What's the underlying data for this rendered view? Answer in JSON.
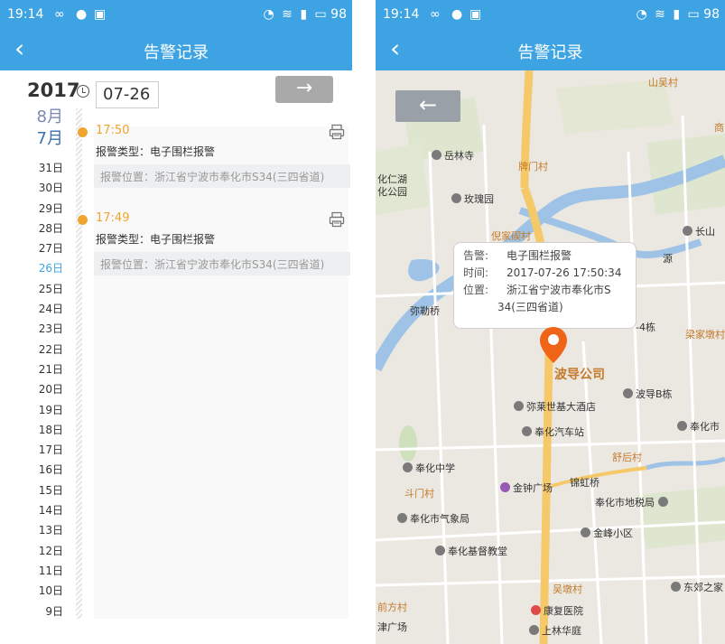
{
  "status_bar": {
    "time": "19:14",
    "battery": "98"
  },
  "left": {
    "title": "告警记录",
    "back_glyph": "‹",
    "year": "2017",
    "date_value": "07-26",
    "next_glyph": "→",
    "months": [
      "8月",
      "7月"
    ],
    "days": [
      "31日",
      "30日",
      "29日",
      "28日",
      "27日",
      "26日",
      "25日",
      "24日",
      "23日",
      "22日",
      "21日",
      "20日",
      "19日",
      "18日",
      "17日",
      "16日",
      "15日",
      "14日",
      "13日",
      "12日",
      "11日",
      "10日",
      "9日"
    ],
    "selected_day": "26日",
    "entries": [
      {
        "time": "17:50",
        "type": "报警类型：电子围栏报警",
        "location": "报警位置：浙江省宁波市奉化市S34(三四省道)"
      },
      {
        "time": "17:49",
        "type": "报警类型：电子围栏报警",
        "location": "报警位置：浙江省宁波市奉化市S34(三四省道)"
      }
    ]
  },
  "right": {
    "title": "告警记录",
    "back_glyph": "‹",
    "map_back_glyph": "←",
    "popup": {
      "alarm_key": "告警:",
      "alarm_val": "电子围栏报警",
      "time_key": "时间:",
      "time_val": "2017-07-26 17:50:34",
      "loc_key": "位置:",
      "loc_val1": "浙江省宁波市奉化市S",
      "loc_val2": "34(三四省道)"
    },
    "map_labels": {
      "yuelinsi": "岳林寺",
      "paimencun": "牌门村",
      "fenghuarenhu": "化仁湖",
      "fenghuagongyuan": "化公园",
      "meiguiyuan": "玫瑰园",
      "nijiadiancun": "倪家碶村",
      "changshan": "长山",
      "shanwucun": "山吴村",
      "shang": "商",
      "mi": "弥勒桥",
      "yuan": "源",
      "lou4": "-4栋",
      "liangjiadun": "梁家墩村",
      "bodao": "波导公司",
      "bodaoB": "波导B栋",
      "milai": "弥莱世基大酒店",
      "fenghuaqiche": "奉化汽车站",
      "fenghuashi": "奉化市",
      "shuhoucun": "舒后村",
      "fenghuazhongxue": "奉化中学",
      "doumencun": "斗门村",
      "jinzhong": "金钟广场",
      "jinhongqiao": "锦虹桥",
      "dishuiju": "奉化市地税局",
      "qixiangju": "奉化市气象局",
      "jinfeng": "金峰小区",
      "jidujiaotang": "奉化基督教堂",
      "wudun": "吴墩村",
      "kangfu": "康复医院",
      "dongjiao": "东郊之家",
      "qianfangcun": "前方村",
      "jinguangchang": "津广场",
      "shanglin": "上林华庭"
    }
  },
  "colors": {
    "header": "#3ea3e2",
    "alarm": "#f0a52e",
    "road": "#f5c96a"
  }
}
